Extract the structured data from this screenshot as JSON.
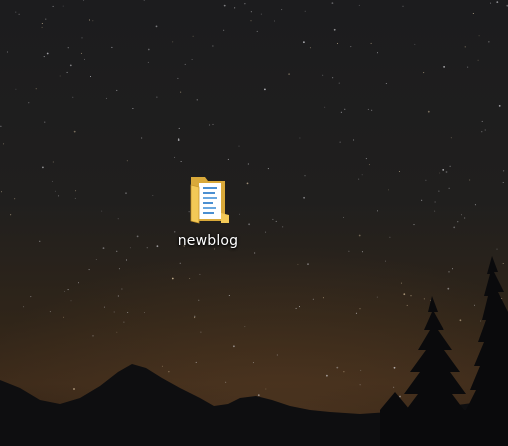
{
  "desktop": {
    "icons": [
      {
        "label": "newblog",
        "icon": "folder-icon"
      }
    ]
  },
  "colors": {
    "sky_top": "#1b1b1d",
    "sky_bottom": "#3a2b1c",
    "horizon_glow": "#5b3f24",
    "silhouette": "#0c0c0e",
    "folder_yellow": "#f3c957",
    "folder_dark": "#d9a93a"
  }
}
